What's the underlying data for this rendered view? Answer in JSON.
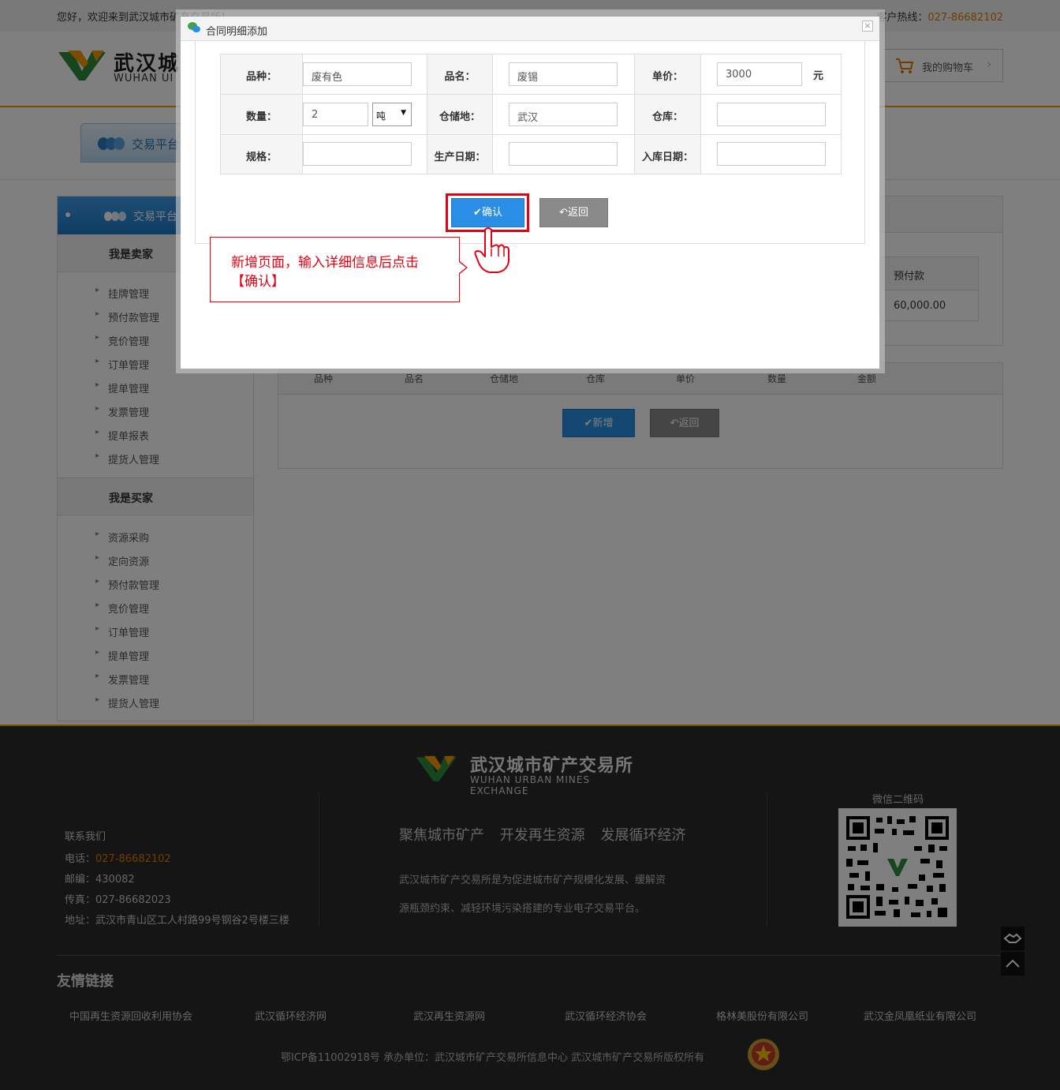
{
  "topbar": {
    "welcome": "您好，欢迎来到武汉城市矿产交易所！",
    "hotline_label": "客户热线：",
    "hotline_number": "027-86682102"
  },
  "header": {
    "logo_cn": "武汉城",
    "logo_en": "WUHAN UI",
    "cart_label": "我的购物车"
  },
  "nav": {
    "tab_label": "交易平台"
  },
  "sidebar": {
    "title": "交易平台",
    "seller_title": "我是卖家",
    "seller_items": [
      "挂牌管理",
      "预付款管理",
      "竞价管理",
      "订单管理",
      "提单管理",
      "发票管理",
      "提单报表",
      "提货人管理"
    ],
    "buyer_title": "我是买家",
    "buyer_items": [
      "资源采购",
      "定向资源",
      "预付款管理",
      "竞价管理",
      "订单管理",
      "提单管理",
      "发票管理",
      "提货人管理"
    ]
  },
  "main": {
    "prepay_header": "预付款",
    "prepay_value": "60,000.00",
    "columns": [
      "品种",
      "品名",
      "仓储地",
      "仓库",
      "单价",
      "数量",
      "金额"
    ],
    "add_button": "新增",
    "back_button": "返回"
  },
  "dialog": {
    "title": "合同明细添加",
    "close": "×",
    "labels": {
      "variety": "品种：",
      "product_name": "品名：",
      "unit_price": "单价：",
      "quantity": "数量：",
      "storage_place": "仓储地：",
      "warehouse": "仓库：",
      "spec": "规格：",
      "production_date": "生产日期：",
      "storage_date": "入库日期："
    },
    "values": {
      "variety": "废有色",
      "product_name": "废锡",
      "unit_price": "3000",
      "currency_unit": "元",
      "quantity": "2",
      "unit_selected": "吨",
      "storage_place": "武汉",
      "warehouse": "",
      "spec": "",
      "production_date": "",
      "storage_date": ""
    },
    "confirm_button": "确认",
    "back_button": "返回",
    "callout_text": "新增页面，输入详细信息后点击【确认】"
  },
  "footer": {
    "logo_cn": "武汉城市矿产交易所",
    "logo_en": "WUHAN URBAN MINES EXCHANGE",
    "contact_title": "联系我们",
    "phone_label": "电话：",
    "phone": "027-86682102",
    "postcode": "邮编：430082",
    "fax": "传真：027-86682023",
    "address": "地址：武汉市青山区工人村路99号钢谷2号楼三楼",
    "slogan": "聚焦城市矿产 开发再生资源 发展循环经济",
    "intro_line1": "武汉城市矿产交易所是为促进城市矿产规模化发展、缓解资",
    "intro_line2": "源瓶颈约束、减轻环境污染搭建的专业电子交易平台。",
    "qr_label": "微信二维码",
    "friend_links_title": "友情链接",
    "friend_links": [
      "中国再生资源回收利用协会",
      "武汉循环经济网",
      "武汉再生资源网",
      "武汉循环经济协会",
      "格林美股份有限公司",
      "武汉金凤凰纸业有限公司"
    ],
    "copyright": "鄂ICP备11002918号  承办单位：武汉城市矿产交易所信息中心  武汉城市矿产交易所版权所有"
  },
  "colors": {
    "accent": "#f39800",
    "primary_blue": "#2a8ee6",
    "highlight_red": "#e60012"
  }
}
